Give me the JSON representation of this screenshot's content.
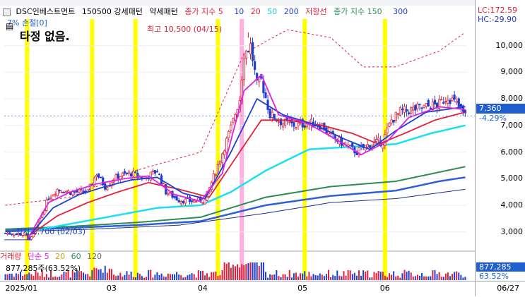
{
  "legend": {
    "title": "DSC인베스트먼트",
    "pattern_strong": "150500 강세패턴",
    "pattern_weak": "약세패턴",
    "ma_label": "종가 지수 5",
    "ma5": "",
    "ma10": "10",
    "ma20": "20",
    "ma50": "50",
    "ma200": "200",
    "resistance": "저항선",
    "close_index": "종가 지수 150",
    "ma150": "",
    "ma300": "300"
  },
  "annotations": {
    "loss": "7% 손절[0]",
    "memo": "타정 없음.",
    "peak": "최고 10,500 (04/15)",
    "trough": "최저 2,700 (02/03)"
  },
  "volume_legend": {
    "title": "거래량",
    "simple": "단순 5",
    "ma20": "20",
    "ma60": "60",
    "ma120": "120",
    "current": "877,285주(63.52%)"
  },
  "axis_panel": {
    "lc": "LC:172.59",
    "hc": "HC:-29.90",
    "current_price": "7,360",
    "current_change": "-4.29%",
    "volume": "877,285",
    "volume_ratio": "63.52%"
  },
  "dates": {
    "labels": [
      "2025/01",
      "03",
      "04",
      "05",
      "06"
    ],
    "end": "06/27"
  },
  "colors": {
    "up": "#e0203a",
    "down": "#1f3fd0",
    "highlight": "#ffff00",
    "highlight_pink": "#ffb0e0",
    "ma5": "#e020e0",
    "ma10": "#1f3fd0",
    "ma20": "#e0203a",
    "ma50": "#19e0f0",
    "ma150": "#2e8b57",
    "ma200": "#2f5fd8",
    "ma300": "#1f2f80",
    "channel": "#e0203a"
  },
  "chart_data": {
    "type": "candlestick",
    "price_ticks": [
      3000,
      4000,
      5000,
      6000,
      7000,
      8000,
      9000,
      10000
    ],
    "ylim": [
      2300,
      11000
    ],
    "highlight_bars": [
      10,
      40,
      60,
      98,
      138,
      175
    ],
    "highlight_pink_bar": 109,
    "bar_count": 213,
    "month_starts": [
      0,
      48,
      90,
      136,
      174
    ],
    "peak": {
      "value": 10500,
      "date": "04/15"
    },
    "trough": {
      "value": 2700,
      "date": "02/03"
    },
    "last_close": 7360,
    "last_change_pct": -4.29,
    "last_volume": 877285,
    "volume_ratio_pct": 63.52,
    "price_anchors": [
      [
        0,
        2950
      ],
      [
        8,
        2900
      ],
      [
        12,
        2750
      ],
      [
        15,
        3300
      ],
      [
        20,
        4300
      ],
      [
        24,
        4600
      ],
      [
        30,
        4500
      ],
      [
        38,
        4500
      ],
      [
        42,
        5200
      ],
      [
        46,
        4700
      ],
      [
        52,
        5100
      ],
      [
        58,
        5200
      ],
      [
        64,
        5000
      ],
      [
        70,
        5300
      ],
      [
        74,
        4500
      ],
      [
        80,
        4200
      ],
      [
        86,
        4150
      ],
      [
        92,
        4200
      ],
      [
        98,
        5500
      ],
      [
        104,
        6900
      ],
      [
        108,
        8000
      ],
      [
        110,
        9700
      ],
      [
        113,
        10000
      ],
      [
        116,
        8500
      ],
      [
        118,
        8700
      ],
      [
        122,
        7400
      ],
      [
        128,
        7100
      ],
      [
        134,
        7000
      ],
      [
        140,
        7100
      ],
      [
        146,
        7000
      ],
      [
        150,
        6600
      ],
      [
        156,
        6300
      ],
      [
        162,
        6000
      ],
      [
        168,
        6300
      ],
      [
        174,
        6400
      ],
      [
        178,
        7200
      ],
      [
        182,
        7500
      ],
      [
        188,
        7600
      ],
      [
        194,
        7700
      ],
      [
        200,
        7800
      ],
      [
        204,
        8100
      ],
      [
        208,
        7800
      ],
      [
        212,
        7360
      ]
    ],
    "ma5_anchors": [
      [
        10,
        2700
      ],
      [
        20,
        4100
      ],
      [
        30,
        4500
      ],
      [
        42,
        4800
      ],
      [
        55,
        5000
      ],
      [
        66,
        5100
      ],
      [
        78,
        4400
      ],
      [
        90,
        4150
      ],
      [
        100,
        5200
      ],
      [
        110,
        8300
      ],
      [
        118,
        8900
      ],
      [
        126,
        7400
      ],
      [
        140,
        7050
      ],
      [
        154,
        6400
      ],
      [
        164,
        5900
      ],
      [
        176,
        6400
      ],
      [
        186,
        7300
      ],
      [
        200,
        7700
      ],
      [
        212,
        7600
      ]
    ],
    "ma10_anchors": [
      [
        10,
        2750
      ],
      [
        22,
        3900
      ],
      [
        34,
        4400
      ],
      [
        46,
        4700
      ],
      [
        58,
        4950
      ],
      [
        70,
        5050
      ],
      [
        82,
        4450
      ],
      [
        92,
        4250
      ],
      [
        104,
        6000
      ],
      [
        116,
        8000
      ],
      [
        128,
        7400
      ],
      [
        142,
        7050
      ],
      [
        156,
        6500
      ],
      [
        168,
        6100
      ],
      [
        180,
        6800
      ],
      [
        194,
        7500
      ],
      [
        212,
        7700
      ]
    ],
    "ma20_anchors": [
      [
        10,
        2800
      ],
      [
        24,
        3600
      ],
      [
        38,
        4100
      ],
      [
        52,
        4500
      ],
      [
        66,
        4850
      ],
      [
        80,
        4600
      ],
      [
        94,
        4300
      ],
      [
        108,
        6000
      ],
      [
        118,
        7200
      ],
      [
        130,
        7200
      ],
      [
        146,
        7000
      ],
      [
        160,
        6700
      ],
      [
        172,
        6300
      ],
      [
        184,
        6700
      ],
      [
        198,
        7200
      ],
      [
        212,
        7500
      ]
    ],
    "ma50_anchors": [
      [
        10,
        3000
      ],
      [
        30,
        3300
      ],
      [
        50,
        3600
      ],
      [
        70,
        3900
      ],
      [
        90,
        4000
      ],
      [
        104,
        4500
      ],
      [
        120,
        5300
      ],
      [
        140,
        6100
      ],
      [
        160,
        6200
      ],
      [
        180,
        6300
      ],
      [
        196,
        6700
      ],
      [
        212,
        7000
      ]
    ],
    "ma150_anchors": [
      [
        0,
        3100
      ],
      [
        30,
        3200
      ],
      [
        60,
        3350
      ],
      [
        90,
        3550
      ],
      [
        120,
        4300
      ],
      [
        150,
        4700
      ],
      [
        180,
        4900
      ],
      [
        212,
        5450
      ]
    ],
    "ma200_anchors": [
      [
        0,
        3050
      ],
      [
        30,
        3150
      ],
      [
        60,
        3250
      ],
      [
        90,
        3400
      ],
      [
        120,
        4000
      ],
      [
        150,
        4350
      ],
      [
        180,
        4550
      ],
      [
        200,
        4900
      ],
      [
        212,
        5050
      ]
    ],
    "ma300_anchors": [
      [
        0,
        3000
      ],
      [
        40,
        3100
      ],
      [
        80,
        3250
      ],
      [
        120,
        3700
      ],
      [
        150,
        4100
      ],
      [
        180,
        4250
      ],
      [
        212,
        4600
      ]
    ],
    "channel_anchors": [
      [
        0,
        4000
      ],
      [
        30,
        4300
      ],
      [
        60,
        5300
      ],
      [
        90,
        6000
      ],
      [
        110,
        9700
      ],
      [
        130,
        10600
      ],
      [
        150,
        10300
      ],
      [
        165,
        9200
      ],
      [
        180,
        9200
      ],
      [
        200,
        9800
      ],
      [
        212,
        10500
      ]
    ]
  }
}
